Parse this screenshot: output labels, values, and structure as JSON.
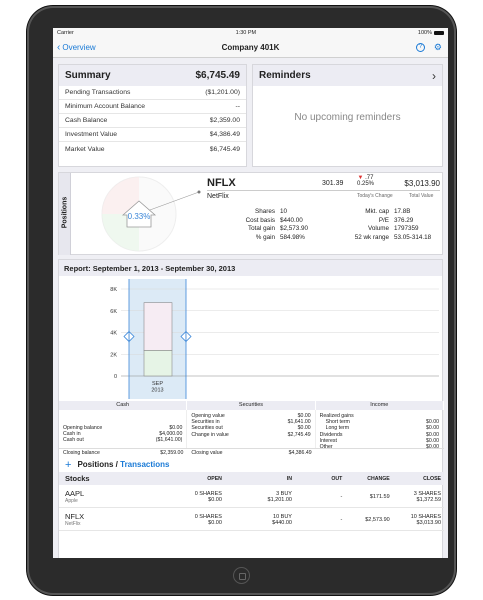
{
  "status": {
    "carrier": "Carrier",
    "time": "1:30 PM",
    "battery": "100%"
  },
  "nav": {
    "back_label": "Overview",
    "title": "Company 401K"
  },
  "summary": {
    "title": "Summary",
    "total": "$6,745.49",
    "rows": [
      {
        "label": "Pending Transactions",
        "value": "($1,201.00)"
      },
      {
        "label": "Minimum Account Balance",
        "value": "--"
      },
      {
        "label": "Cash Balance",
        "value": "$2,359.00"
      },
      {
        "label": "Investment Value",
        "value": "$4,386.49"
      },
      {
        "label": "Market Value",
        "value": "$6,745.49"
      }
    ]
  },
  "reminders": {
    "title": "Reminders",
    "empty_text": "No upcoming reminders"
  },
  "positions": {
    "tab_label": "Positions",
    "pie_label": "0.33%",
    "symbol": "NFLX",
    "price": "301.39",
    "change": ".77",
    "change_pct": "0.25%",
    "total": "$3,013.90",
    "name": "NetFlix",
    "todays_change_label": "Today's Change",
    "total_value_label": "Total Value",
    "left_stats": [
      {
        "label": "Shares",
        "value": "10"
      },
      {
        "label": "Cost basis",
        "value": "$440.00"
      },
      {
        "label": "Total gain",
        "value": "$2,573.90"
      },
      {
        "label": "% gain",
        "value": "584.98%"
      }
    ],
    "right_stats": [
      {
        "label": "Mkt. cap",
        "value": "17.8B"
      },
      {
        "label": "P/E",
        "value": "376.29"
      },
      {
        "label": "Volume",
        "value": "1797359"
      },
      {
        "label": "52 wk range",
        "value": "53.05-314.18"
      }
    ]
  },
  "report": {
    "title": "Report: September 1, 2013 - September 30, 2013",
    "headers": [
      "Cash",
      "Securities",
      "Income"
    ],
    "cash": {
      "lines": [
        {
          "label": "Opening balance",
          "value": "$0.00"
        },
        {
          "label": "Cash in",
          "value": "$4,000.00"
        },
        {
          "label": "Cash out",
          "value": "($1,641.00)"
        }
      ],
      "closing": {
        "label": "Closing balance",
        "value": "$2,359.00"
      }
    },
    "securities": {
      "lines": [
        {
          "label": "Opening value",
          "value": "$0.00"
        },
        {
          "label": "Securities in",
          "value": "$1,641.00"
        },
        {
          "label": "Securities out",
          "value": "$0.00"
        },
        {
          "label": "Change in value",
          "value": "$2,745.49"
        }
      ],
      "closing": {
        "label": "Closing value",
        "value": "$4,386.49"
      }
    },
    "income": {
      "lines": [
        {
          "label": "Realized gains",
          "value": ""
        },
        {
          "label": "Short term",
          "value": "$0.00"
        },
        {
          "label": "Long term",
          "value": "$0.00"
        },
        {
          "label": "Dividends",
          "value": "$0.00"
        },
        {
          "label": "Interest",
          "value": "$0.00"
        },
        {
          "label": "Other",
          "value": "$0.00"
        }
      ]
    }
  },
  "chart_data": {
    "type": "bar",
    "categories": [
      "SEP 2013"
    ],
    "series": [
      {
        "values": [
          2359
        ]
      },
      {
        "values": [
          4386.49
        ]
      }
    ],
    "yticks": [
      "8K",
      "6K",
      "4K",
      "2K",
      "0"
    ],
    "ylim": [
      0,
      8000
    ],
    "grid": true,
    "colors": {
      "cash": "#e6f4e6",
      "securities": "#f6ecf3",
      "band": "#d6e6f5",
      "handle": "#3a86d8"
    }
  },
  "trades": {
    "section_title": "Positions",
    "section_sep": " / ",
    "section_link": "Transactions",
    "columns": [
      "Stocks",
      "OPEN",
      "IN",
      "OUT",
      "CHANGE",
      "CLOSE"
    ],
    "rows": [
      {
        "symbol": "AAPL",
        "name": "Apple",
        "open1": "0 SHARES",
        "open2": "$0.00",
        "in1": "3 BUY",
        "in2": "$1,201.00",
        "out": "-",
        "change": "$171.59",
        "close1": "3 SHARES",
        "close2": "$1,372.59"
      },
      {
        "symbol": "NFLX",
        "name": "NetFlix",
        "open1": "0 SHARES",
        "open2": "$0.00",
        "in1": "10 BUY",
        "in2": "$440.00",
        "out": "-",
        "change": "$2,573.90",
        "close1": "10 SHARES",
        "close2": "$3,013.90"
      }
    ]
  }
}
